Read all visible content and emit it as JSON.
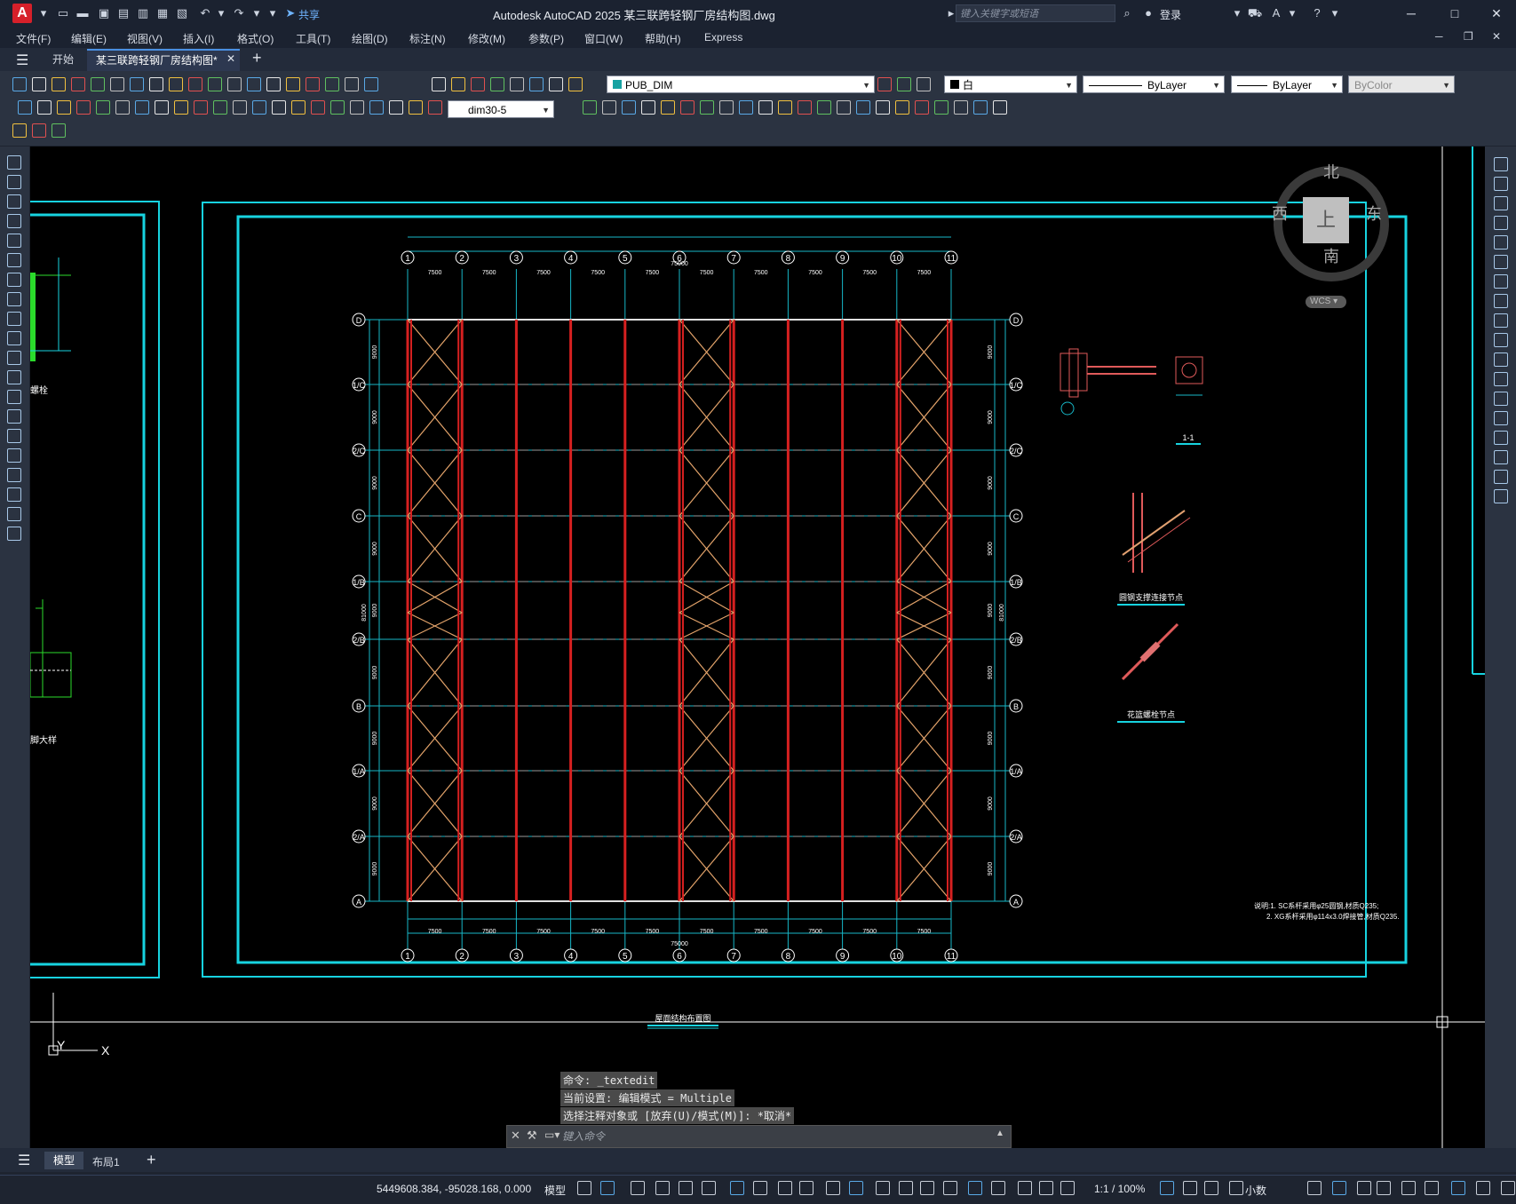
{
  "window": {
    "app_badge": "A",
    "title": "Autodesk AutoCAD 2025    某三联跨轻钢厂房结构图.dwg",
    "share": "共享",
    "search_placeholder": "键入关键字或短语",
    "login": "登录",
    "controls": [
      "─",
      "□",
      "✕"
    ]
  },
  "menu": [
    "文件(F)",
    "编辑(E)",
    "视图(V)",
    "插入(I)",
    "格式(O)",
    "工具(T)",
    "绘图(D)",
    "标注(N)",
    "修改(M)",
    "参数(P)",
    "窗口(W)",
    "帮助(H)",
    "Express"
  ],
  "tabs": {
    "start": "开始",
    "document": "某三联跨轻钢厂房结构图*",
    "close": "✕",
    "new": "+"
  },
  "toolbar": {
    "layer": "PUB_DIM",
    "color": "白",
    "linetype": "ByLayer",
    "lineweight": "ByLayer",
    "plotstyle": "ByColor",
    "dimstyle": "dim30-5"
  },
  "viewcube": {
    "north": "北",
    "south": "南",
    "east": "东",
    "west": "西",
    "top": "上",
    "wcs": "WCS"
  },
  "drawing": {
    "column_labels": [
      "1",
      "2",
      "3",
      "4",
      "5",
      "6",
      "7",
      "8",
      "9",
      "10",
      "11"
    ],
    "bay_dims": [
      "7500",
      "7500",
      "7500",
      "7500",
      "7500",
      "7500",
      "7500",
      "7500",
      "7500",
      "7500"
    ],
    "total_length": "75000",
    "row_labels_left": [
      "D",
      "1/C",
      "2/C",
      "C",
      "1/B",
      "2/B",
      "B",
      "1/A",
      "2/A",
      "A"
    ],
    "row_dims": [
      "9000",
      "9000",
      "9000",
      "9000",
      "9000",
      "9000",
      "9000",
      "9000",
      "9000"
    ],
    "total_width": "81000",
    "plan_title": "屋面结构布置图",
    "detail_section": "1-1",
    "detail_round_brace": "圆钢支撑连接节点",
    "detail_turnbuckle": "花篮螺栓节点",
    "left_label_1": "螺栓",
    "left_label_2": "脚大样",
    "notes": [
      "说明:1. SC系杆采用φ25圆钢,材质Q235;",
      "2. XG系杆采用φ114x3.0焊接管,材质Q235."
    ],
    "ucs_x": "X",
    "ucs_y": "Y"
  },
  "command": {
    "history": [
      "命令: _textedit",
      "当前设置: 编辑模式 = Multiple",
      "选择注释对象或 [放弃(U)/模式(M)]: *取消*"
    ],
    "input_placeholder": "键入命令"
  },
  "layout_tabs": {
    "model": "模型",
    "layout1": "布局1",
    "add": "+"
  },
  "status": {
    "coordinates": "5449608.384, -95028.168, 0.000",
    "space": "模型",
    "scale": "1:1 / 100%",
    "units": "小数"
  }
}
